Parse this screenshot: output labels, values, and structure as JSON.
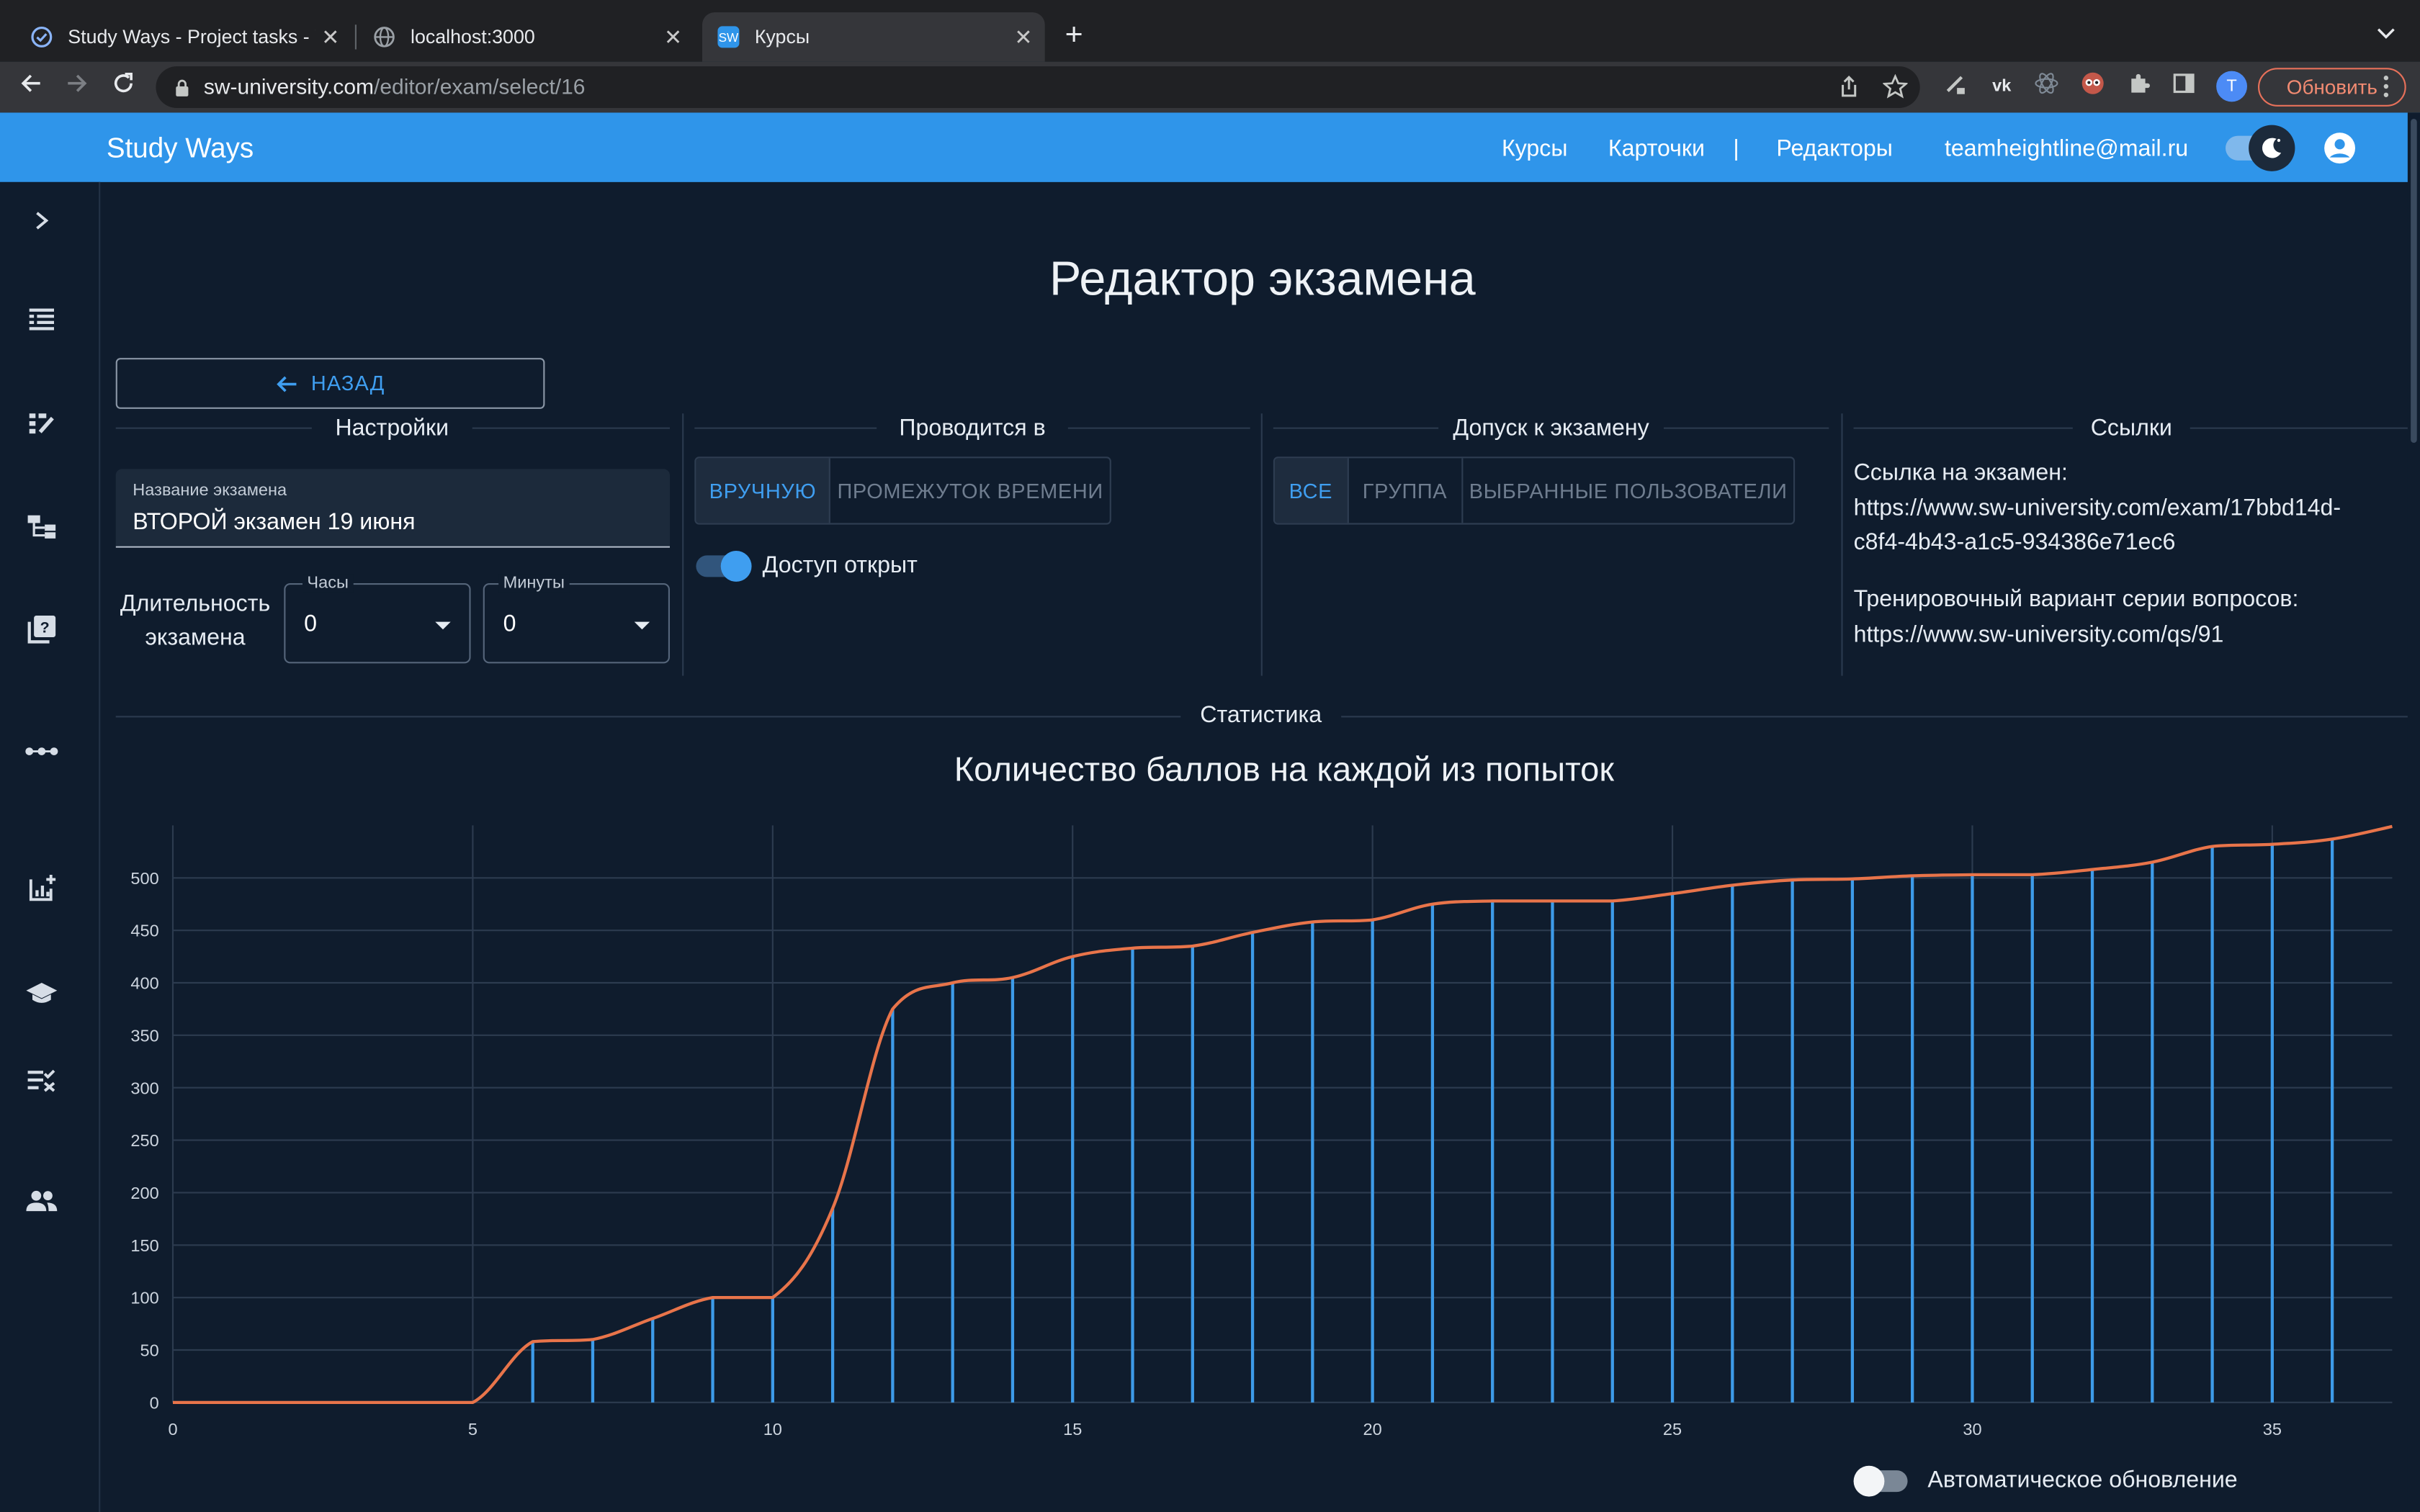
{
  "browser": {
    "tabs": [
      {
        "title": "Study Ways - Project tasks - W",
        "icon": "check-circle-icon"
      },
      {
        "title": "localhost:3000",
        "icon": "globe-icon"
      },
      {
        "title": "Курсы",
        "icon": "sw-favicon",
        "favicon_text": "SW"
      }
    ],
    "url_host": "sw-university.com",
    "url_path": "/editor/exam/select/16",
    "profile_letter": "T",
    "update_label": "Обновить"
  },
  "appbar": {
    "brand": "Study Ways",
    "nav": [
      "Курсы",
      "Карточки",
      "|",
      "Редакторы"
    ],
    "email": "teamheightline@mail.ru"
  },
  "page": {
    "title": "Редактор экзамена",
    "back_label": "НАЗАД"
  },
  "settings": {
    "title": "Настройки",
    "name_label": "Название экзамена",
    "name_value": "ВТОРОЙ экзамен 19 июня",
    "duration_label_line1": "Длительность",
    "duration_label_line2": "экзамена",
    "hours_label": "Часы",
    "hours_value": "0",
    "minutes_label": "Минуты",
    "minutes_value": "0"
  },
  "held": {
    "title": "Проводится в",
    "options": [
      "ВРУЧНУЮ",
      "ПРОМЕЖУТОК ВРЕМЕНИ"
    ],
    "selected": "ВРУЧНУЮ",
    "access_label": "Доступ открыт",
    "access_on": true
  },
  "admission": {
    "title": "Допуск к экзамену",
    "options": [
      "ВСЕ",
      "ГРУППА",
      "ВЫБРАННЫЕ ПОЛЬЗОВАТЕЛИ"
    ],
    "selected": "ВСЕ"
  },
  "links": {
    "title": "Ссылки",
    "exam_label": "Ссылка на экзамен:",
    "exam_url_line1": "https://www.sw-university.com/exam/17bbd14d-",
    "exam_url_line2": "c8f4-4b43-a1c5-934386e71ec6",
    "training_label": "Тренировочный вариант серии вопросов:",
    "training_url": "https://www.sw-university.com/qs/91"
  },
  "statistics": {
    "title": "Статистика",
    "auto_update_label": "Автоматическое обновление",
    "auto_update_on": false
  },
  "colors": {
    "appbar": "#2f95ea",
    "accent": "#3f9ef0",
    "curve": "#e8744a",
    "bars": "#3d9be9",
    "background": "#0f1c2d"
  },
  "chart_data": {
    "type": "line",
    "title": "Количество баллов на каждой из попыток",
    "x": [
      0,
      1,
      2,
      3,
      4,
      5,
      6,
      7,
      8,
      9,
      10,
      11,
      12,
      13,
      14,
      15,
      16,
      17,
      18,
      19,
      20,
      21,
      22,
      23,
      24,
      25,
      26,
      27,
      28,
      29,
      30,
      31,
      32,
      33,
      34,
      35,
      36,
      37
    ],
    "values": [
      0,
      0,
      0,
      0,
      0,
      0,
      58,
      60,
      80,
      100,
      100,
      185,
      375,
      400,
      405,
      425,
      433,
      435,
      448,
      458,
      460,
      475,
      478,
      478,
      478,
      485,
      493,
      498,
      499,
      502,
      503,
      503,
      508,
      515,
      530,
      532,
      537,
      549
    ],
    "bar_x": [
      6,
      7,
      8,
      9,
      10,
      11,
      12,
      13,
      14,
      15,
      16,
      17,
      18,
      19,
      20,
      21,
      22,
      23,
      24,
      25,
      26,
      27,
      28,
      29,
      30,
      31,
      32,
      33,
      34,
      35,
      36
    ],
    "x_ticks": [
      0,
      5,
      10,
      15,
      20,
      25,
      30,
      35
    ],
    "y_ticks": [
      0,
      50,
      100,
      150,
      200,
      250,
      300,
      350,
      400,
      450,
      500
    ],
    "xlim": [
      0,
      37
    ],
    "ylim": [
      0,
      550
    ],
    "grid": true,
    "legend": "none"
  }
}
